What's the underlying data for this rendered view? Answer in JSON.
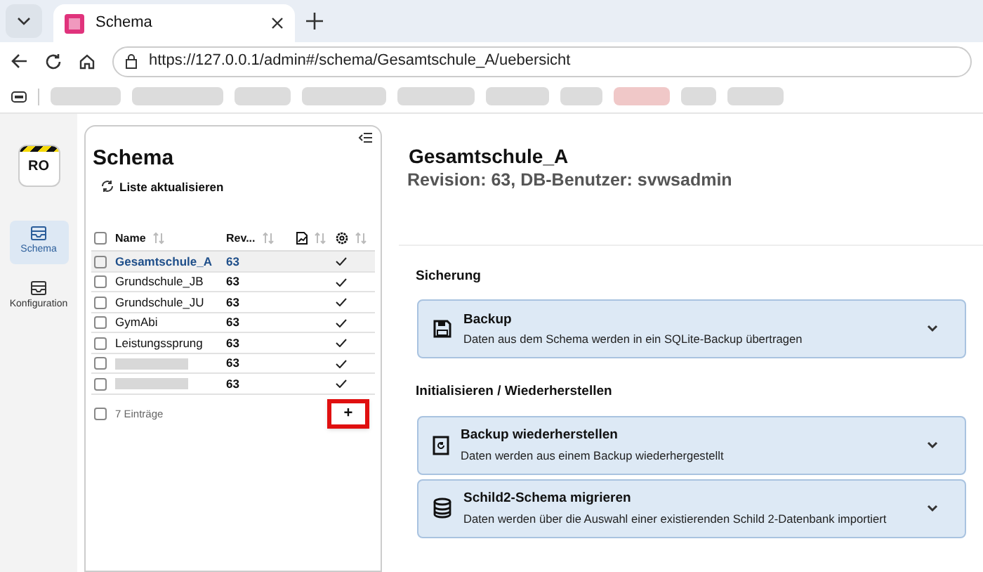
{
  "browser": {
    "tab": {
      "title": "Schema",
      "selected": true
    },
    "url": "https://127.0.0.1/admin#/schema/Gesamtschule_A/uebersicht"
  },
  "app_nav": {
    "badge": "RO",
    "items": [
      {
        "label": "Schema",
        "selected": true
      },
      {
        "label": "Konfiguration",
        "selected": false
      }
    ]
  },
  "schema_list": {
    "title": "Schema",
    "refresh": "Liste aktualisieren",
    "columns": [
      "Name",
      "Rev..."
    ],
    "select_all_checked": false,
    "footer_checked": false,
    "rows": [
      {
        "name": "Gesamtschule_A",
        "revision": "63",
        "enabled": true,
        "selected": true,
        "checked": false
      },
      {
        "name": "Grundschule_JB",
        "revision": "63",
        "enabled": true,
        "selected": false,
        "checked": false
      },
      {
        "name": "Grundschule_JU",
        "revision": "63",
        "enabled": true,
        "selected": false,
        "checked": false
      },
      {
        "name": "GymAbi",
        "revision": "63",
        "enabled": true,
        "selected": false,
        "checked": false
      },
      {
        "name": "Leistungssprung",
        "revision": "63",
        "enabled": true,
        "selected": false,
        "checked": false
      },
      {
        "blurred": true,
        "revision": "63",
        "enabled": true,
        "selected": false,
        "checked": false
      },
      {
        "blurred": true,
        "revision": "63",
        "enabled": true,
        "selected": false,
        "checked": false
      }
    ],
    "footer": "7 Einträge",
    "add_button": "+"
  },
  "detail": {
    "title": "Gesamtschule_A",
    "subtitle": "Revision: 63, DB-Benutzer: svwsadmin",
    "sections": [
      {
        "heading": "Sicherung",
        "items": [
          {
            "kind": "save",
            "title": "Backup",
            "description": "Daten aus dem Schema werden in ein SQLite-Backup übertragen"
          }
        ]
      },
      {
        "heading": "Initialisieren / Wiederherstellen",
        "items": [
          {
            "kind": "restore",
            "title": "Backup wiederherstellen",
            "description": "Daten werden aus einem Backup wiederhergestellt"
          },
          {
            "kind": "database",
            "title": "Schild2-Schema migrieren",
            "description": "Daten werden über die Auswahl einer existierenden Schild 2-Datenbank importiert"
          }
        ]
      }
    ]
  }
}
